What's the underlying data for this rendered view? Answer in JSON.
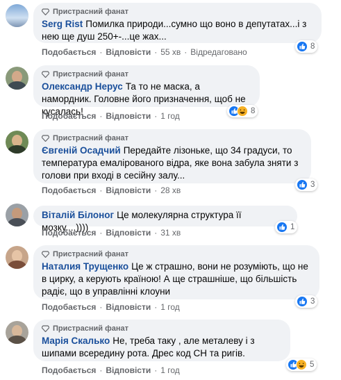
{
  "badge_label": "Пристрасний фанат",
  "comments": [
    {
      "author": "Serg Rist",
      "text": "Помилка природи...сумно що воно в депутатах...і з нею ще душ 250+-...це жах...",
      "like_label": "Подобається",
      "reply_label": "Відповісти",
      "time": "55 хв",
      "edited": "Відредаговано",
      "reactions": [
        "like"
      ],
      "reaction_count": "8"
    },
    {
      "author": "Олександр Нерус",
      "text": "Та то не маска, а намордник. Головне його призначення, щоб не кусалась!",
      "like_label": "Подобається",
      "reply_label": "Відповісти",
      "time": "1 год",
      "reactions": [
        "like",
        "haha"
      ],
      "reaction_count": "8"
    },
    {
      "author": "Євгеній Осадчий",
      "text": "Передайте лізоньке, що 34 градуси, то температура емалірованого відра, яке вона забула зняти з голови при вході в сесійну залу...",
      "like_label": "Подобається",
      "reply_label": "Відповісти",
      "time": "28 хв",
      "reactions": [
        "like"
      ],
      "reaction_count": "3"
    },
    {
      "author": "Віталій Білоног",
      "text": "Це молекулярна структура її мозку....))))",
      "like_label": "Подобається",
      "reply_label": "Відповісти",
      "time": "31 хв",
      "reactions": [
        "like"
      ],
      "reaction_count": "1"
    },
    {
      "author": "Наталия Трущенко",
      "text": "Це ж страшно, вони не розуміють, що не в цирку, а керують країною! А ще страшніше, що більшість радіє, що в управлінні клоуни",
      "like_label": "Подобається",
      "reply_label": "Відповісти",
      "time": "1 год",
      "reactions": [
        "like"
      ],
      "reaction_count": "3"
    },
    {
      "author": "Марія Скалько",
      "text": "Не, треба таку , але металеву і з шипами всередину рота. Дрес код СН та ригів.",
      "like_label": "Подобається",
      "reply_label": "Відповісти",
      "time": "1 год",
      "reactions": [
        "like",
        "haha"
      ],
      "reaction_count": "5"
    }
  ],
  "colors": {
    "author": "#1a4f9b",
    "bubble": "#f0f2f5",
    "meta": "#65676b",
    "like": "#1877f2",
    "haha": "#f7b125"
  }
}
